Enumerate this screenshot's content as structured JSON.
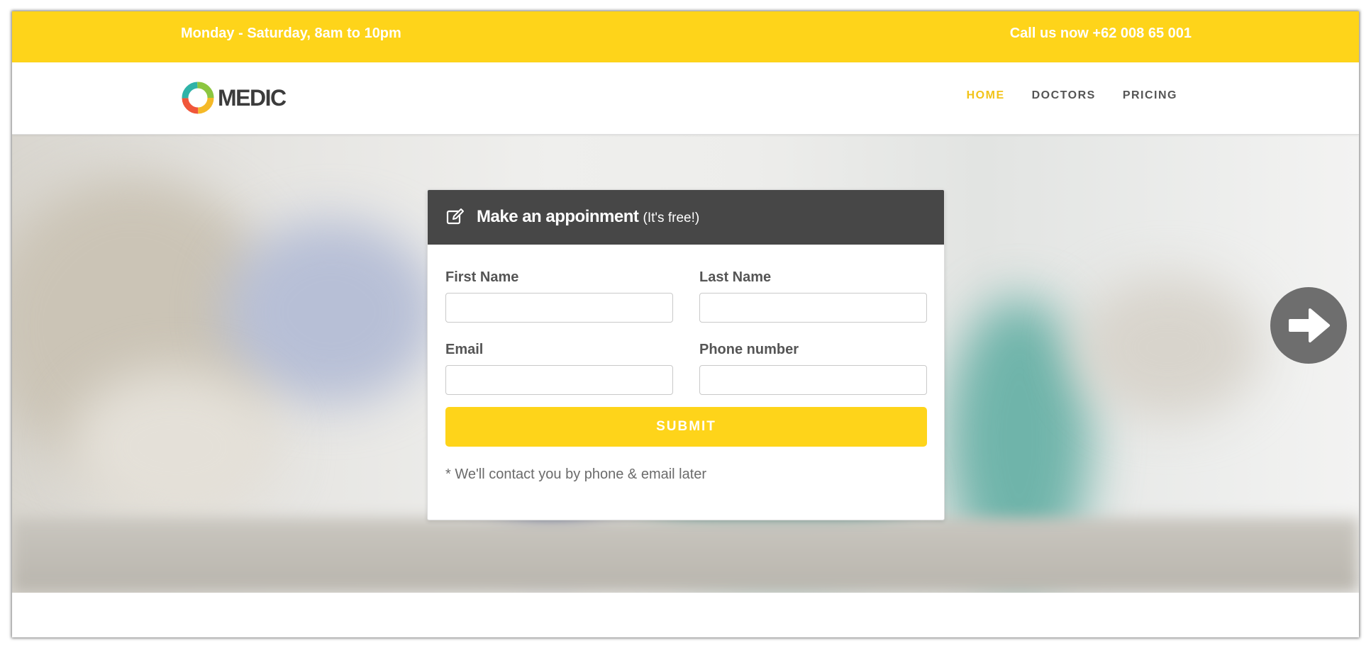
{
  "topbar": {
    "hours": "Monday - Saturday, 8am to 10pm",
    "call": "Call us now +62 008 65 001"
  },
  "brand": {
    "logo_icon": "medic-ring-logo",
    "name": "MEDIC"
  },
  "nav": {
    "items": [
      {
        "label": "HOME",
        "active": true
      },
      {
        "label": "DOCTORS",
        "active": false
      },
      {
        "label": "PRICING",
        "active": false
      }
    ]
  },
  "form": {
    "icon": "edit-icon",
    "title": "Make an appoinment",
    "subtitle": "(It's free!)",
    "fields": {
      "first_name": {
        "label": "First Name",
        "value": "",
        "placeholder": ""
      },
      "last_name": {
        "label": "Last Name",
        "value": "",
        "placeholder": ""
      },
      "email": {
        "label": "Email",
        "value": "",
        "placeholder": ""
      },
      "phone": {
        "label": "Phone number",
        "value": "",
        "placeholder": ""
      }
    },
    "submit_label": "SUBMIT",
    "note": "* We'll contact you by phone & email later"
  },
  "slider": {
    "next_icon": "arrow-right-circle-icon"
  },
  "colors": {
    "accent": "#fed41a",
    "nav_active": "#f2c318",
    "form_header": "#474747",
    "text": "#555555"
  }
}
